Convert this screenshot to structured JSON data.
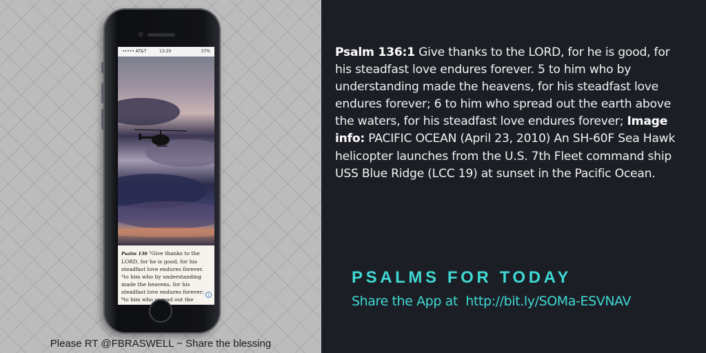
{
  "left_panel": {
    "phone": {
      "status_bar": {
        "carrier": "••••• AT&T",
        "time": "13:20",
        "battery": "37%"
      },
      "verse_preview": {
        "ref": "Psalm 136",
        "text": " ¹Give thanks to the LORD, for he is good, for his steadfast love endures forever. ²to him who by understanding made the heavens, for his steadfast love endures forever; ⁶to him who spread out the"
      },
      "info_icon": "info-icon"
    },
    "credit": "Please RT @FBRASWELL ~ Share the blessing"
  },
  "right_panel": {
    "passage": {
      "ref_label": "Psalm 136:1",
      "verse_text": " Give thanks to the LORD, for he is good, for his steadfast love endures forever. 5 to him who by understanding made the heavens, for his steadfast love endures forever; 6 to him who spread out the earth above the waters, for his steadfast love endures forever;",
      "image_info_label": "Image info:",
      "image_info_text": " PACIFIC OCEAN (April 23, 2010) An SH-60F Sea Hawk helicopter launches from the U.S. 7th Fleet command ship USS Blue Ridge (LCC 19) at sunset in the Pacific Ocean."
    },
    "app_title": "PSALMS FOR TODAY",
    "share_text": "Share the App at  http://bit.ly/SOMa-ESVNAV"
  },
  "colors": {
    "accent": "#3ed9d3",
    "background_dark": "#1c1e25",
    "background_light": "#bcbcbc"
  }
}
